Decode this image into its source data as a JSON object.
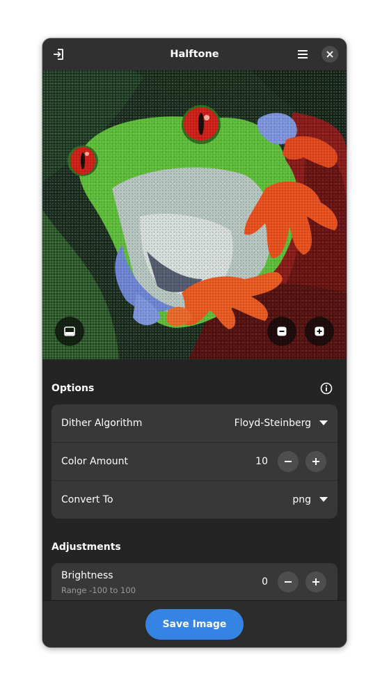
{
  "window": {
    "title": "Halftone",
    "icons": {
      "open": "open-file-icon",
      "menu": "hamburger-menu-icon",
      "close": "close-icon"
    }
  },
  "image": {
    "description_icons": {
      "toggle_panel": "panel-toggle-icon",
      "zoom_out": "zoom-out-icon",
      "zoom_in": "zoom-in-icon"
    }
  },
  "options": {
    "title": "Options",
    "info_icon": "info-icon",
    "rows": {
      "dither": {
        "label": "Dither Algorithm",
        "value": "Floyd-Steinberg"
      },
      "colors": {
        "label": "Color Amount",
        "value": "10"
      },
      "convert": {
        "label": "Convert To",
        "value": "png"
      }
    }
  },
  "adjustments": {
    "title": "Adjustments",
    "brightness": {
      "label": "Brightness",
      "subtitle": "Range -100 to 100",
      "value": "0"
    }
  },
  "actions": {
    "save_label": "Save Image"
  },
  "colors": {
    "accent": "#3584e4",
    "window_bg": "#242424",
    "card_bg": "#383838"
  }
}
